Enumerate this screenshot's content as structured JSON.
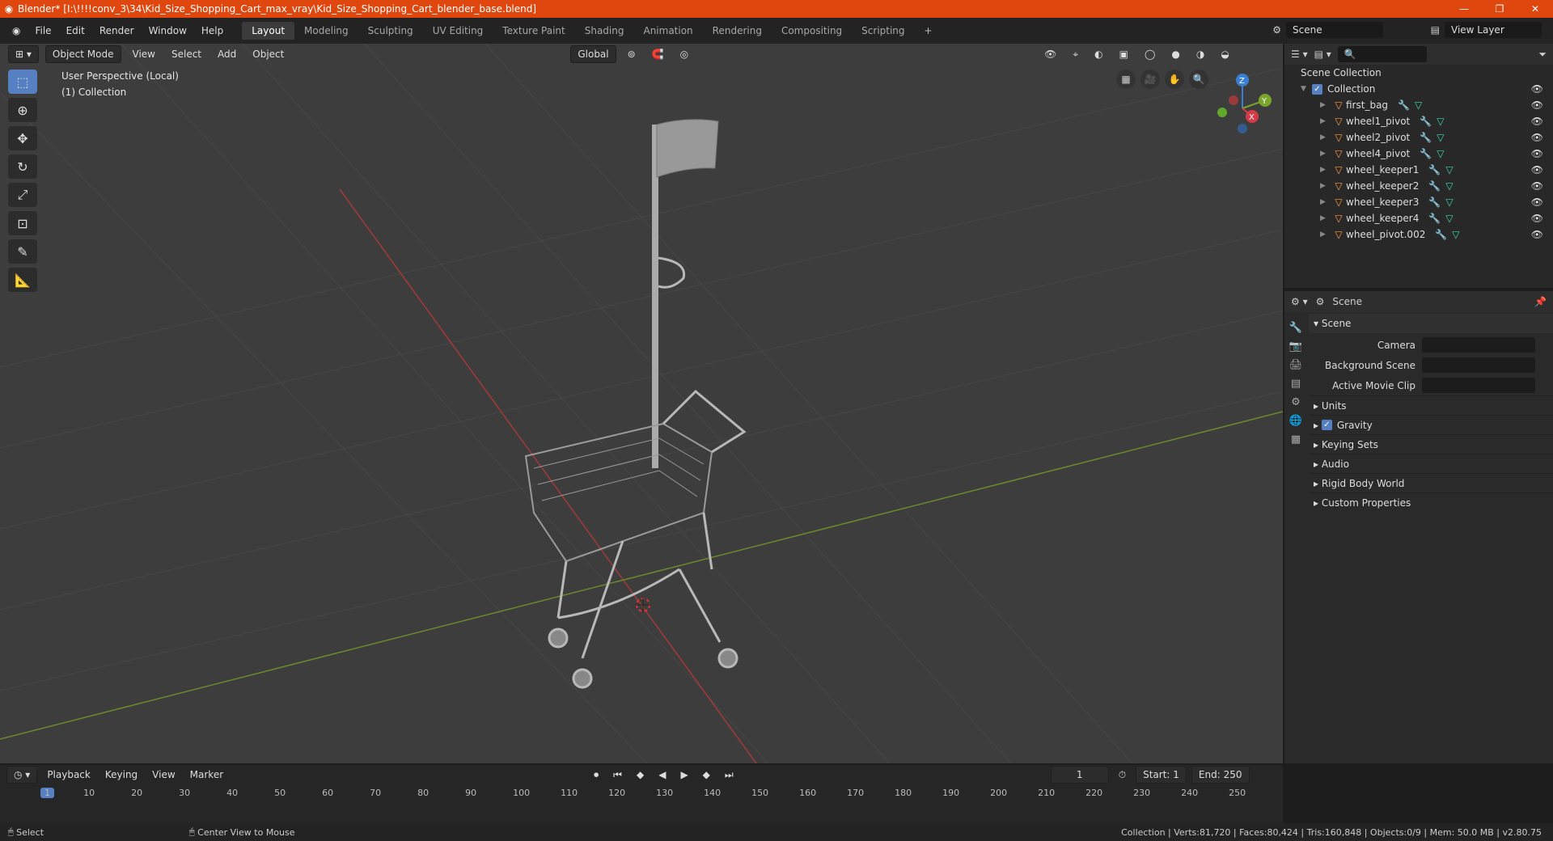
{
  "window": {
    "title": "Blender* [I:\\!!!!conv_3\\34\\Kid_Size_Shopping_Cart_max_vray\\Kid_Size_Shopping_Cart_blender_base.blend]",
    "controls": [
      "—",
      "❐",
      "✕"
    ]
  },
  "menu": [
    "File",
    "Edit",
    "Render",
    "Window",
    "Help"
  ],
  "workspaces": [
    "Layout",
    "Modeling",
    "Sculpting",
    "UV Editing",
    "Texture Paint",
    "Shading",
    "Animation",
    "Rendering",
    "Compositing",
    "Scripting"
  ],
  "active_workspace": "Layout",
  "scene_name": "Scene",
  "view_layer": "View Layer",
  "viewport": {
    "mode": "Object Mode",
    "menus": [
      "View",
      "Select",
      "Add",
      "Object"
    ],
    "orientation": "Global",
    "perspective_label": "User Perspective (Local)",
    "collection_label": "(1) Collection",
    "gizmo_axes": [
      "Z",
      "Y",
      "X"
    ]
  },
  "outliner": {
    "root": "Scene Collection",
    "collection": "Collection",
    "items": [
      "first_bag",
      "wheel1_pivot",
      "wheel2_pivot",
      "wheel4_pivot",
      "wheel_keeper1",
      "wheel_keeper2",
      "wheel_keeper3",
      "wheel_keeper4",
      "wheel_pivot.002"
    ]
  },
  "properties": {
    "header": "Scene",
    "panel": "Scene",
    "fields": [
      {
        "label": "Camera"
      },
      {
        "label": "Background Scene"
      },
      {
        "label": "Active Movie Clip"
      }
    ],
    "subpanels": [
      "Units",
      "Gravity",
      "Keying Sets",
      "Audio",
      "Rigid Body World",
      "Custom Properties"
    ]
  },
  "timeline": {
    "menus": [
      "Playback",
      "Keying",
      "View",
      "Marker"
    ],
    "current_frame": "1",
    "start_label": "Start:",
    "start": "1",
    "end_label": "End:",
    "end": "250",
    "ticks": [
      "1",
      "10",
      "20",
      "30",
      "40",
      "50",
      "60",
      "70",
      "80",
      "90",
      "100",
      "110",
      "120",
      "130",
      "140",
      "150",
      "160",
      "170",
      "180",
      "190",
      "200",
      "210",
      "220",
      "230",
      "240",
      "250"
    ]
  },
  "status": {
    "left": "Select",
    "middle": "Center View to Mouse",
    "right": "Collection | Verts:81,720 | Faces:80,424 | Tris:160,848 | Objects:0/9 | Mem: 50.0 MB | v2.80.75"
  }
}
